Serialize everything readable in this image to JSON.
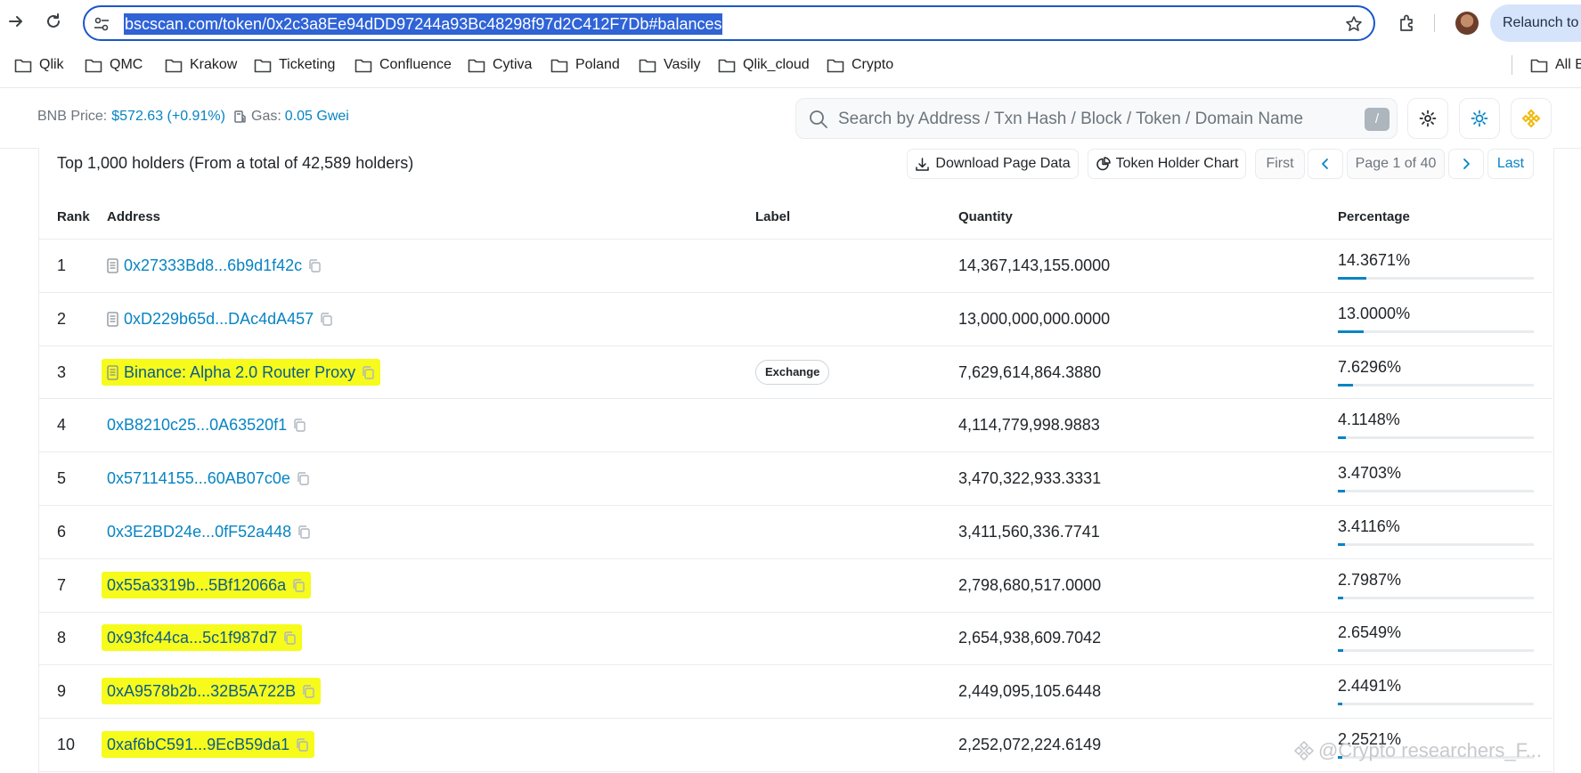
{
  "browser": {
    "url": "bscscan.com/token/0x2c3a8Ee94dDD97244a93Bc48298f97d2C412F7Db#balances",
    "relaunch_label": "Relaunch to u",
    "bookmarks": [
      "Qlik",
      "QMC",
      "Krakow",
      "Ticketing",
      "Confluence",
      "Cytiva",
      "Poland",
      "Vasily",
      "Qlik_cloud",
      "Crypto"
    ],
    "all_bookmarks_label": "All B"
  },
  "header": {
    "bnb_label": "BNB Price:",
    "bnb_value": "$572.63 (+0.91%)",
    "gas_label": "Gas:",
    "gas_value": "0.05 Gwei",
    "search_placeholder": "Search by Address / Txn Hash / Block / Token / Domain Name",
    "search_shortcut": "/",
    "accent": "#0784c3",
    "bnb_color": "#f0b90b"
  },
  "holders": {
    "summary": "Top 1,000 holders (From a total of 42,589 holders)",
    "download_label": "Download Page Data",
    "chart_label": "Token Holder Chart",
    "first_label": "First",
    "page_label": "Page 1 of 40",
    "last_label": "Last",
    "columns": {
      "rank": "Rank",
      "address": "Address",
      "label": "Label",
      "quantity": "Quantity",
      "percentage": "Percentage"
    },
    "rows": [
      {
        "rank": "1",
        "address": "0x27333Bd8...6b9d1f42c",
        "contract": true,
        "highlighted": false,
        "label": "",
        "quantity": "14,367,143,155.0000",
        "percentage": "14.3671%",
        "share": 14.3671
      },
      {
        "rank": "2",
        "address": "0xD229b65d...DAc4dA457",
        "contract": true,
        "highlighted": false,
        "label": "",
        "quantity": "13,000,000,000.0000",
        "percentage": "13.0000%",
        "share": 13.0
      },
      {
        "rank": "3",
        "address": "Binance: Alpha 2.0 Router Proxy",
        "contract": true,
        "highlighted": true,
        "label": "Exchange",
        "quantity": "7,629,614,864.3880",
        "percentage": "7.6296%",
        "share": 7.6296
      },
      {
        "rank": "4",
        "address": "0xB8210c25...0A63520f1",
        "contract": false,
        "highlighted": false,
        "label": "",
        "quantity": "4,114,779,998.9883",
        "percentage": "4.1148%",
        "share": 4.1148
      },
      {
        "rank": "5",
        "address": "0x57114155...60AB07c0e",
        "contract": false,
        "highlighted": false,
        "label": "",
        "quantity": "3,470,322,933.3331",
        "percentage": "3.4703%",
        "share": 3.4703
      },
      {
        "rank": "6",
        "address": "0x3E2BD24e...0fF52a448",
        "contract": false,
        "highlighted": false,
        "label": "",
        "quantity": "3,411,560,336.7741",
        "percentage": "3.4116%",
        "share": 3.4116
      },
      {
        "rank": "7",
        "address": "0x55a3319b...5Bf12066a",
        "contract": false,
        "highlighted": true,
        "label": "",
        "quantity": "2,798,680,517.0000",
        "percentage": "2.7987%",
        "share": 2.7987
      },
      {
        "rank": "8",
        "address": "0x93fc44ca...5c1f987d7",
        "contract": false,
        "highlighted": true,
        "label": "",
        "quantity": "2,654,938,609.7042",
        "percentage": "2.6549%",
        "share": 2.6549
      },
      {
        "rank": "9",
        "address": "0xA9578b2b...32B5A722B",
        "contract": false,
        "highlighted": true,
        "label": "",
        "quantity": "2,449,095,105.6448",
        "percentage": "2.4491%",
        "share": 2.4491
      },
      {
        "rank": "10",
        "address": "0xaf6bC591...9EcB59da1",
        "contract": false,
        "highlighted": true,
        "label": "",
        "quantity": "2,252,072,224.6149",
        "percentage": "2.2521%",
        "share": 2.2521
      }
    ]
  },
  "watermark": "@Crypto researchers_F..."
}
